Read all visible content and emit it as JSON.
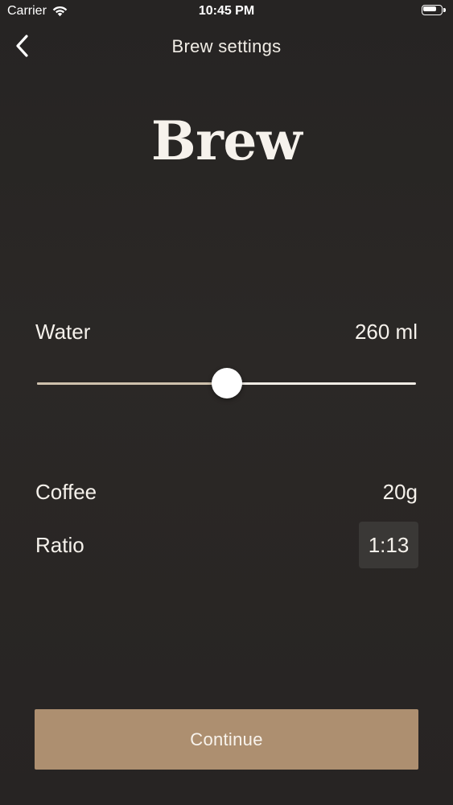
{
  "status_bar": {
    "carrier": "Carrier",
    "time": "10:45 PM",
    "battery_level": 0.85
  },
  "nav": {
    "title": "Brew settings",
    "back_icon": "chevron-left-icon"
  },
  "hero": {
    "title": "Brew"
  },
  "water": {
    "label": "Water",
    "value": "260 ml",
    "slider_fraction": 0.5
  },
  "coffee": {
    "label": "Coffee",
    "value": "20g"
  },
  "ratio": {
    "label": "Ratio",
    "value": "1:13"
  },
  "actions": {
    "continue_label": "Continue"
  },
  "colors": {
    "background": "#272524",
    "accent": "#ad8f70",
    "text": "#f5f1eb",
    "ratio_pill": "#3a3836"
  }
}
